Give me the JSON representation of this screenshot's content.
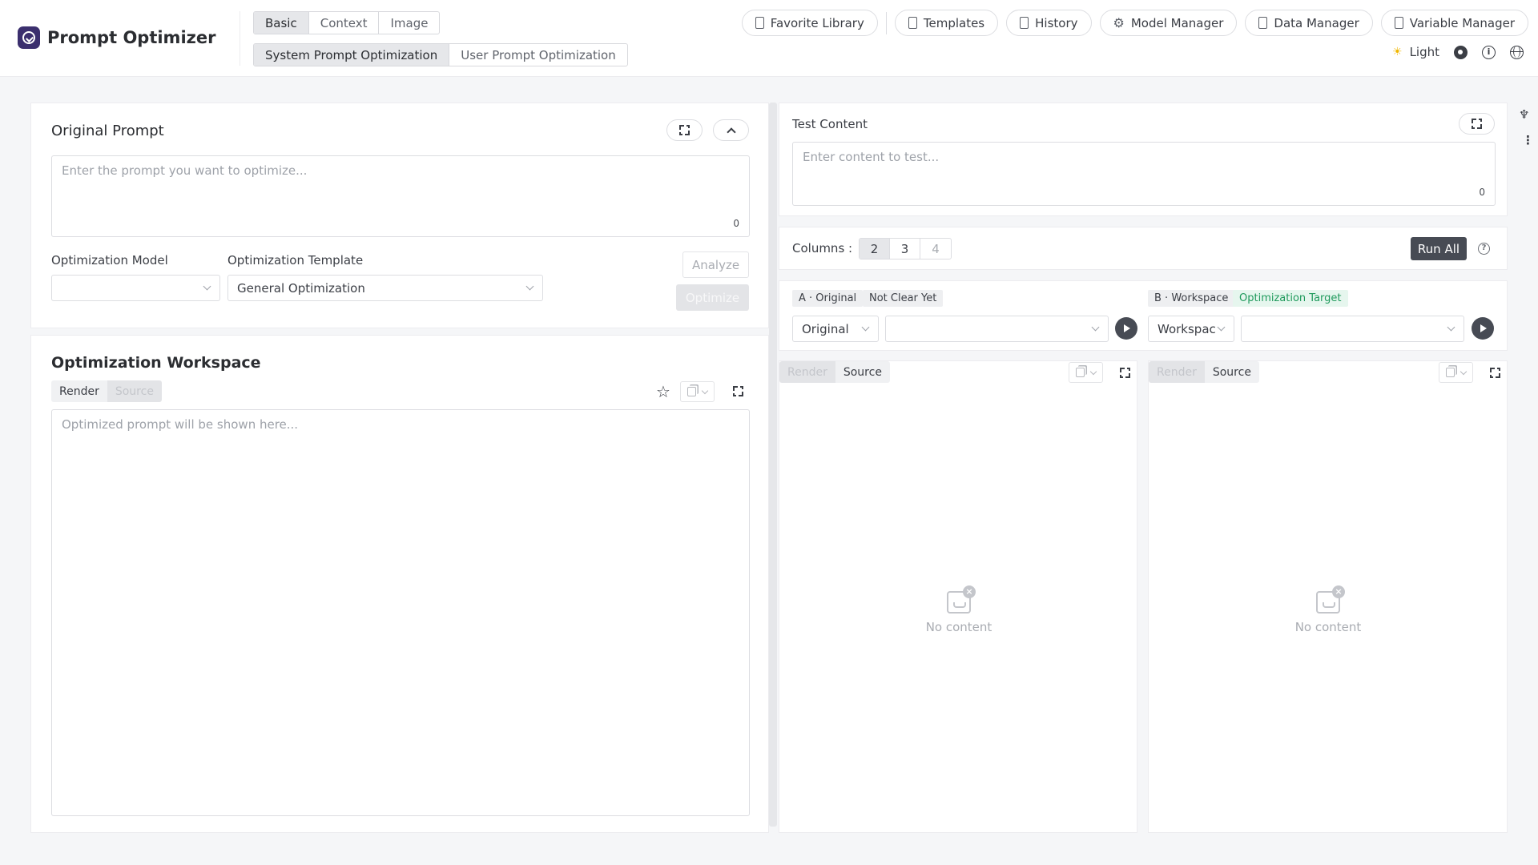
{
  "app": {
    "title": "Prompt Optimizer"
  },
  "mode_tabs": [
    "Basic",
    "Context",
    "Image"
  ],
  "optimization_tabs": [
    "System Prompt Optimization",
    "User Prompt Optimization"
  ],
  "nav": {
    "favorite": "Favorite Library",
    "templates": "Templates",
    "history": "History",
    "model_manager": "Model Manager",
    "data_manager": "Data Manager",
    "variable_manager": "Variable Manager"
  },
  "theme": {
    "label": "Light"
  },
  "original": {
    "title": "Original Prompt",
    "placeholder": "Enter the prompt you want to optimize...",
    "count": "0",
    "model_label": "Optimization Model",
    "model_value": "",
    "template_label": "Optimization Template",
    "template_value": "General Optimization",
    "analyze": "Analyze",
    "optimize": "Optimize"
  },
  "workspace": {
    "title": "Optimization Workspace",
    "render": "Render",
    "source": "Source",
    "placeholder": "Optimized prompt will be shown here..."
  },
  "test": {
    "title": "Test Content",
    "placeholder": "Enter content to test...",
    "count": "0",
    "columns_label": "Columns :",
    "columns": [
      "2",
      "3",
      "4"
    ],
    "run_all": "Run All"
  },
  "col_a": {
    "tag": "A · Original",
    "status": "Not Clear Yet",
    "source_select": "Original",
    "model_select": "",
    "render": "Render",
    "source": "Source",
    "empty": "No content"
  },
  "col_b": {
    "tag": "B · Workspace",
    "status": "Optimization Target",
    "source_select": "Workspace",
    "model_select": "",
    "render": "Render",
    "source": "Source",
    "empty": "No content"
  },
  "colors": {
    "accent": "#3b2f6e",
    "dark_button": "#474b54",
    "success": "#1f9a5c"
  }
}
